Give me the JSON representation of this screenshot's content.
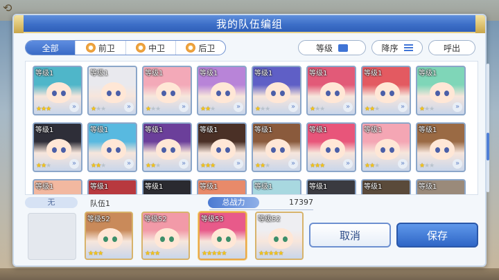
{
  "dialog": {
    "title": "我的队伍编组"
  },
  "filters": {
    "tabs": [
      {
        "label": "全部",
        "active": true,
        "icon": null
      },
      {
        "label": "前卫",
        "active": false,
        "icon": "position-icon"
      },
      {
        "label": "中卫",
        "active": false,
        "icon": "position-icon"
      },
      {
        "label": "后卫",
        "active": false,
        "icon": "position-icon"
      }
    ],
    "sort_level_label": "等级",
    "sort_order_label": "降序",
    "call_out_label": "呼出"
  },
  "roster": {
    "cards": [
      {
        "level": "等级1",
        "stars": 3,
        "hair": "#4fb6c9"
      },
      {
        "level": "等级1",
        "stars": 1,
        "hair": "#e9e9ee"
      },
      {
        "level": "等级1",
        "stars": 1,
        "hair": "#f3a9b8"
      },
      {
        "level": "等级1",
        "stars": 2,
        "hair": "#b884d8"
      },
      {
        "level": "等级1",
        "stars": 1,
        "hair": "#5f5fc6"
      },
      {
        "level": "等级1",
        "stars": 1,
        "hair": "#e25a78"
      },
      {
        "level": "等级1",
        "stars": 2,
        "hair": "#e35a61"
      },
      {
        "level": "等级1",
        "stars": 1,
        "hair": "#7fd6b8"
      },
      {
        "level": "等级1",
        "stars": 2,
        "hair": "#2e2e38"
      },
      {
        "level": "等级1",
        "stars": 2,
        "hair": "#58b9e0"
      },
      {
        "level": "等级1",
        "stars": 2,
        "hair": "#6b3f9a"
      },
      {
        "level": "等级1",
        "stars": 3,
        "hair": "#4a3026"
      },
      {
        "level": "等级1",
        "stars": 2,
        "hair": "#8a5a3c"
      },
      {
        "level": "等级1",
        "stars": 3,
        "hair": "#e8557a"
      },
      {
        "level": "等级1",
        "stars": 2,
        "hair": "#f4a6b4"
      },
      {
        "level": "等级1",
        "stars": 1,
        "hair": "#9a6a44"
      },
      {
        "level": "等级1",
        "stars": 0,
        "hair": "#f2b8a0"
      },
      {
        "level": "等级1",
        "stars": 0,
        "hair": "#b8393f"
      },
      {
        "level": "等级1",
        "stars": 0,
        "hair": "#2a2a30"
      },
      {
        "level": "等级1",
        "stars": 0,
        "hair": "#e88a6a"
      },
      {
        "level": "等级1",
        "stars": 0,
        "hair": "#a8d8e0"
      },
      {
        "level": "等级1",
        "stars": 0,
        "hair": "#3a3a40"
      },
      {
        "level": "等级1",
        "stars": 0,
        "hair": "#5a4a3a"
      },
      {
        "level": "等级1",
        "stars": 0,
        "hair": "#9a8a7a"
      }
    ]
  },
  "party": {
    "none_label": "无",
    "team_name": "队伍1",
    "power_label": "总战力",
    "power_value": "17397",
    "members": [
      {
        "level": "等级52",
        "stars": 3,
        "hair": "#c98a5a"
      },
      {
        "level": "等级52",
        "stars": 3,
        "hair": "#f29aa8"
      },
      {
        "level": "等级53",
        "stars": 5,
        "hair": "#e85a8a"
      },
      {
        "level": "等级52",
        "stars": 5,
        "hair": "#eeeef2"
      }
    ]
  },
  "buttons": {
    "cancel_label": "取消",
    "save_label": "保存"
  }
}
